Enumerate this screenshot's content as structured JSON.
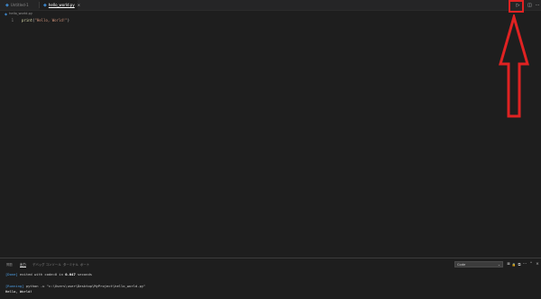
{
  "colors": {
    "background": "#1e1e1e",
    "tab_bar": "#252526",
    "highlight": "#e02222",
    "python_icon": "#3b82c4",
    "output_tag": "#4ea1e8"
  },
  "tabs": [
    {
      "label": "Untitled-1",
      "icon": "python-file-icon",
      "active": false
    },
    {
      "label": "hello_world.py",
      "icon": "python-file-icon",
      "active": true,
      "close": "×"
    }
  ],
  "toolbar": {
    "run_icon": "▷",
    "split_icon": "◫",
    "more_icon": "···"
  },
  "breadcrumb": {
    "file": "hello_world.py"
  },
  "editor": {
    "lines": [
      {
        "number": "1",
        "fn": "print",
        "open": "(",
        "str": "\"Hello, World!\"",
        "close": ")"
      }
    ]
  },
  "annotation": {
    "type": "arrow-up",
    "target": "run-button"
  },
  "panel": {
    "tabs": [
      "問題",
      "出力",
      "デバッグ コンソール",
      "ターミナル",
      "ポート"
    ],
    "active_tab_index": 1,
    "channel": "Code",
    "channel_chevron": "⌄",
    "icons": {
      "list": "≣",
      "lock": "🔒",
      "copy": "⧉",
      "more": "···",
      "chevron": "⌃",
      "close": "×"
    },
    "output": {
      "done_tag": "[Done]",
      "done_text": " exited with code=0 in ",
      "done_time": "0.047",
      "done_suffix": " seconds",
      "running_tag": "[Running]",
      "running_cmd": " python -u \"c:\\Users\\user\\Desktop\\MyProject\\hello_world.py\"",
      "result": "Hello, World!"
    }
  }
}
